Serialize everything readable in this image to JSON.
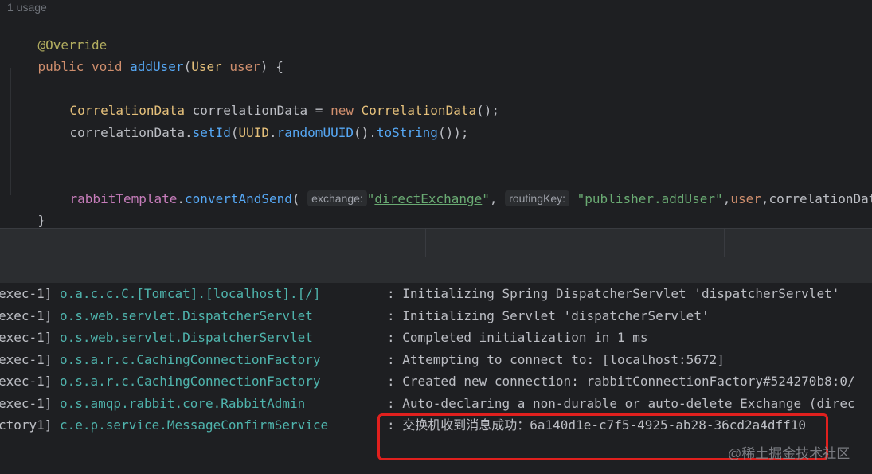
{
  "editor": {
    "usage_hint": "1 usage",
    "annotation": "@Override",
    "method_sig": {
      "mod": "public",
      "ret": "void",
      "name": "addUser",
      "paren_open": "(",
      "ptype": "User",
      "pname": "user",
      "paren_close": ") {"
    },
    "line_corr": {
      "type": "CorrelationData",
      "var": " correlationData = ",
      "new_kw": "new",
      "ctor": " CorrelationData",
      "end": "();"
    },
    "line_setid": {
      "obj": "correlationData.",
      "method": "setId",
      "p1": "(",
      "uuid": "UUID",
      "dot1": ".",
      "random": "randomUUID",
      "p2": "().",
      "tostr": "toString",
      "end": "());"
    },
    "line_send": {
      "field": "rabbitTemplate",
      "dot": ".",
      "method": "convertAndSend",
      "paren": "(",
      "hint_exchange": "exchange:",
      "q1": "\"",
      "exchange_val": "directExchange",
      "q2": "\"",
      "comma1": ", ",
      "hint_routing": "routingKey:",
      "routing_val": "\"publisher.addUser\"",
      "comma2": ",",
      "user": "user",
      "rest": ",correlationDat"
    },
    "close_brace": "}"
  },
  "console": {
    "lines": [
      {
        "thread": "exec-1]",
        "logger": "o.a.c.c.C.[Tomcat].[localhost].[/]",
        "message": ": Initializing Spring DispatcherServlet 'dispatcherServlet'"
      },
      {
        "thread": "exec-1]",
        "logger": "o.s.web.servlet.DispatcherServlet",
        "message": ": Initializing Servlet 'dispatcherServlet'"
      },
      {
        "thread": "exec-1]",
        "logger": "o.s.web.servlet.DispatcherServlet",
        "message": ": Completed initialization in 1 ms"
      },
      {
        "thread": "exec-1]",
        "logger": "o.s.a.r.c.CachingConnectionFactory",
        "message": ": Attempting to connect to: [localhost:5672]"
      },
      {
        "thread": "exec-1]",
        "logger": "o.s.a.r.c.CachingConnectionFactory",
        "message": ": Created new connection: rabbitConnectionFactory#524270b8:0/"
      },
      {
        "thread": "exec-1]",
        "logger": "o.s.amqp.rabbit.core.RabbitAdmin",
        "message": ": Auto-declaring a non-durable or auto-delete Exchange (direc"
      },
      {
        "thread": "ctory1]",
        "logger": "c.e.p.service.MessageConfirmService",
        "message": ": 交换机收到消息成功：6a140d1e-c7f5-4925-ab28-36cd2a4dff10"
      }
    ]
  },
  "watermark": "@稀土掘金技术社区",
  "colors": {
    "highlight": "#e0201e",
    "logger": "#4fb4ad",
    "background": "#1e1f22"
  }
}
